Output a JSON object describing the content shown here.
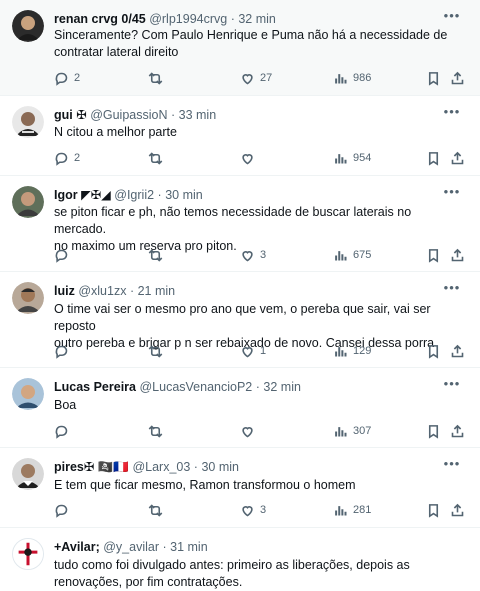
{
  "tweets": [
    {
      "name": "renan crvg 0/45",
      "handle": "@rlp1994crvg",
      "dot": "·",
      "time": "32 min",
      "text_lines": [
        "Sinceramente? Com Paulo Henrique e Puma não há a necessidade de",
        "contratar lateral direito"
      ],
      "replies": "2",
      "retweets": "",
      "likes": "27",
      "views": "986",
      "avatar_color": "#3a3a3a"
    },
    {
      "name": "gui ✠",
      "handle": "@GuipassioN",
      "dot": "·",
      "time": "33 min",
      "text_lines": [
        "N citou a melhor parte"
      ],
      "replies": "2",
      "retweets": "",
      "likes": "",
      "views": "954",
      "avatar_color": "#5a5a5a"
    },
    {
      "name": "Igor ◤✠◢",
      "handle": "@Igrii2",
      "dot": "·",
      "time": "30 min",
      "text_lines": [
        "se piton ficar e ph, não temos necessidade de buscar laterais no mercado.",
        "no maximo um reserva pro piton."
      ],
      "replies": "",
      "retweets": "",
      "likes": "3",
      "views": "675",
      "avatar_color": "#6b5a4a"
    },
    {
      "name": "luiz",
      "handle": "@xlu1zx",
      "dot": "·",
      "time": "21 min",
      "text_lines": [
        "O time vai ser o mesmo pro ano que vem, o pereba que sair, vai ser reposto",
        "outro pereba e brigar p n ser rebaixado de novo. Cansei dessa porra"
      ],
      "replies": "",
      "retweets": "",
      "likes": "1",
      "views": "129",
      "avatar_color": "#8a7a6a"
    },
    {
      "name": "Lucas Pereira",
      "handle": "@LucasVenancioP2",
      "dot": "·",
      "time": "32 min",
      "text_lines": [
        "Boa"
      ],
      "replies": "",
      "retweets": "",
      "likes": "",
      "views": "307",
      "avatar_color": "#a8b4c0"
    },
    {
      "name": "pires✠ 🏴‍☠️🇫🇷",
      "handle": "@Larx_03",
      "dot": "·",
      "time": "30 min",
      "text_lines": [
        "E tem que ficar mesmo, Ramon transformou o homem"
      ],
      "replies": "",
      "retweets": "",
      "likes": "3",
      "views": "281",
      "avatar_color": "#4a4a4a"
    },
    {
      "name": "+Avilar;",
      "handle": "@y_avilar",
      "dot": "·",
      "time": "31 min",
      "text_lines": [
        "tudo como foi divulgado antes: primeiro as liberações, depois as",
        "renovações, por fim contratações."
      ],
      "replies": "",
      "retweets": "",
      "likes": "",
      "views": "",
      "avatar_color": "#ffffff"
    }
  ],
  "colors": {
    "text": "#0f1419",
    "secondary": "#536471",
    "divider": "#eff3f4",
    "highlight_bg": "#f7f9f9"
  },
  "icons": {
    "reply": "reply-icon",
    "retweet": "retweet-icon",
    "like": "like-icon",
    "views": "views-icon",
    "bookmark": "bookmark-icon",
    "share": "share-icon",
    "more": "more-icon"
  }
}
